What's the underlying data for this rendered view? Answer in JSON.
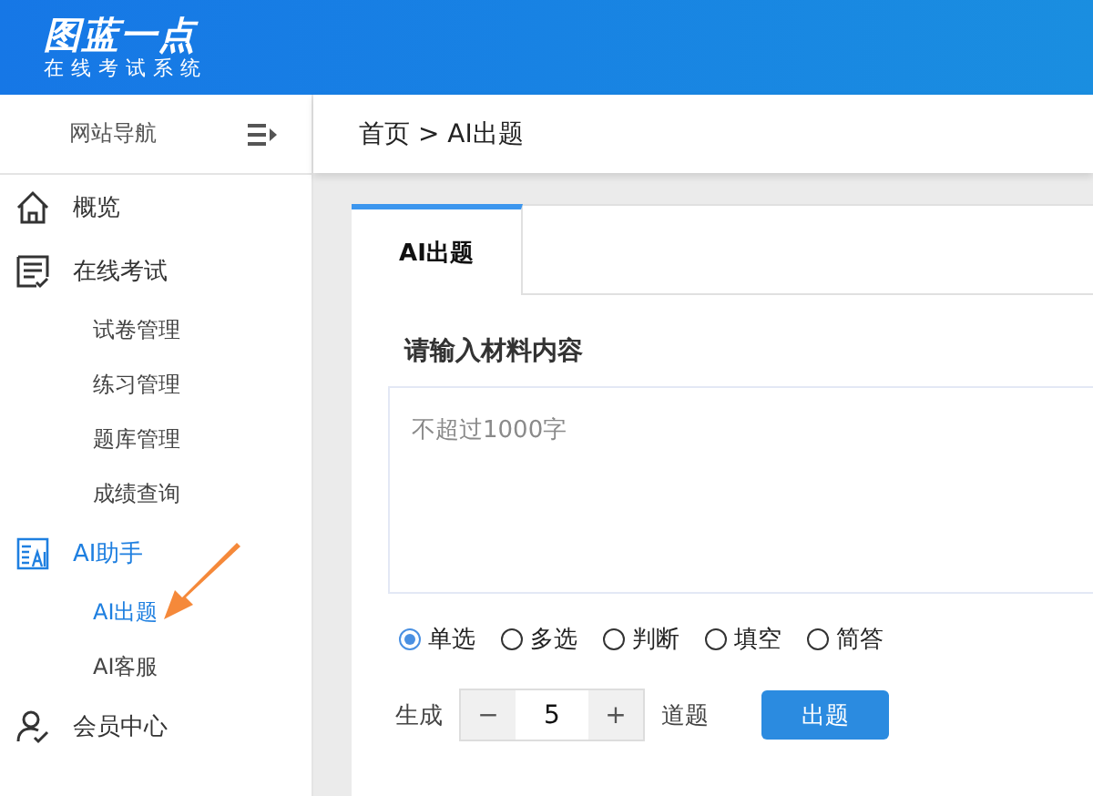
{
  "logo": {
    "title": "图蓝一点",
    "subtitle": "在线考试系统"
  },
  "sidebar": {
    "title": "网站导航",
    "items": [
      {
        "label": "概览",
        "selected": false
      },
      {
        "label": "在线考试",
        "selected": false,
        "children": [
          {
            "label": "试卷管理",
            "selected": false
          },
          {
            "label": "练习管理",
            "selected": false
          },
          {
            "label": "题库管理",
            "selected": false
          },
          {
            "label": "成绩查询",
            "selected": false
          }
        ]
      },
      {
        "label": "AI助手",
        "selected": true,
        "children": [
          {
            "label": "AI出题",
            "selected": true
          },
          {
            "label": "AI客服",
            "selected": false
          }
        ]
      },
      {
        "label": "会员中心",
        "selected": false
      }
    ]
  },
  "breadcrumb": "首页 > AI出题",
  "tabs": [
    {
      "label": "AI出题",
      "selected": true
    }
  ],
  "material": {
    "label": "请输入材料内容",
    "placeholder": "不超过1000字"
  },
  "question_types": [
    {
      "label": "单选",
      "selected": true
    },
    {
      "label": "多选",
      "selected": false
    },
    {
      "label": "判断",
      "selected": false
    },
    {
      "label": "填空",
      "selected": false
    },
    {
      "label": "简答",
      "selected": false
    }
  ],
  "generate": {
    "prefix": "生成",
    "decrement": "−",
    "value": "5",
    "increment": "+",
    "suffix": "道题",
    "button": "出题"
  }
}
